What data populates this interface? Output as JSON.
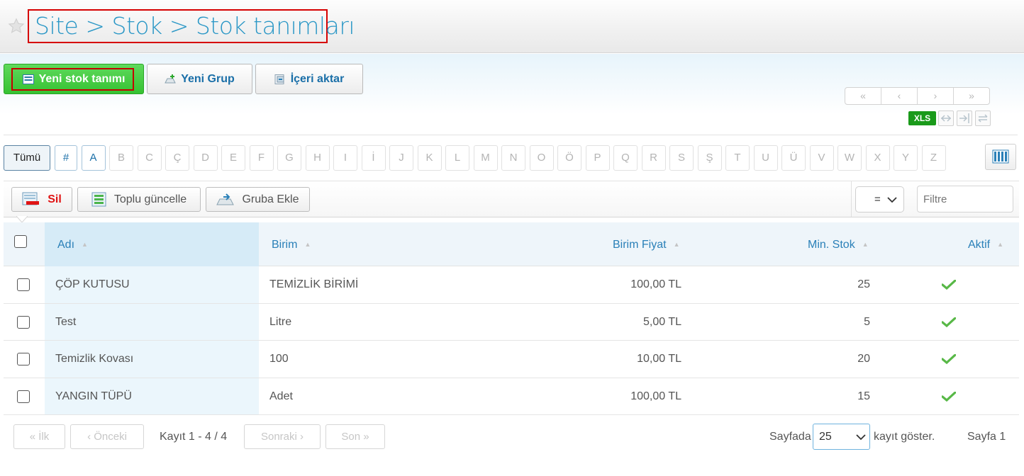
{
  "header": {
    "breadcrumb": [
      "Site",
      ">",
      "Stok",
      ">",
      "Stok tanımları"
    ]
  },
  "toolbar": {
    "new_stock_label": "Yeni stok tanımı",
    "new_group_label": "Yeni Grup",
    "import_label": "İçeri aktar",
    "pager_top": [
      "«",
      "‹",
      "›",
      "»"
    ],
    "xls_label": "XLS"
  },
  "letters": [
    "Tümü",
    "#",
    "A",
    "B",
    "C",
    "Ç",
    "D",
    "E",
    "F",
    "G",
    "H",
    "I",
    "İ",
    "J",
    "K",
    "L",
    "M",
    "N",
    "O",
    "Ö",
    "P",
    "Q",
    "R",
    "S",
    "Ş",
    "T",
    "U",
    "Ü",
    "V",
    "W",
    "X",
    "Y",
    "Z"
  ],
  "grid_toolbar": {
    "delete_label": "Sil",
    "bulk_update_label": "Toplu güncelle",
    "add_to_group_label": "Gruba Ekle",
    "operator_value": "=",
    "filter_placeholder": "Filtre"
  },
  "table": {
    "columns": [
      "Adı",
      "Birim",
      "Birim Fiyat",
      "Min. Stok",
      "Aktif"
    ],
    "rows": [
      {
        "adi": "ÇÖP KUTUSU",
        "birim": "TEMİZLİK BİRİMİ",
        "fiyat": "100,00 TL",
        "min_stok": "25",
        "aktif": true
      },
      {
        "adi": "Test",
        "birim": "Litre",
        "fiyat": "5,00 TL",
        "min_stok": "5",
        "aktif": true
      },
      {
        "adi": "Temizlik Kovası",
        "birim": "100",
        "fiyat": "10,00 TL",
        "min_stok": "20",
        "aktif": true
      },
      {
        "adi": "YANGIN TÜPÜ",
        "birim": "Adet",
        "fiyat": "100,00 TL",
        "min_stok": "15",
        "aktif": true
      }
    ]
  },
  "footer": {
    "first_label": "« İlk",
    "prev_label": "‹ Önceki",
    "record_info": "Kayıt 1 - 4 / 4",
    "next_label": "Sonraki ›",
    "last_label": "Son »",
    "per_page_prefix": "Sayfada",
    "page_size": "25",
    "per_page_suffix": "kayıt göster.",
    "page_label": "Sayfa 1"
  },
  "colors": {
    "accent": "#2a97c6",
    "primary_button": "#36c233",
    "highlight_border": "#d60000",
    "xls_badge": "#1a9a1a"
  }
}
